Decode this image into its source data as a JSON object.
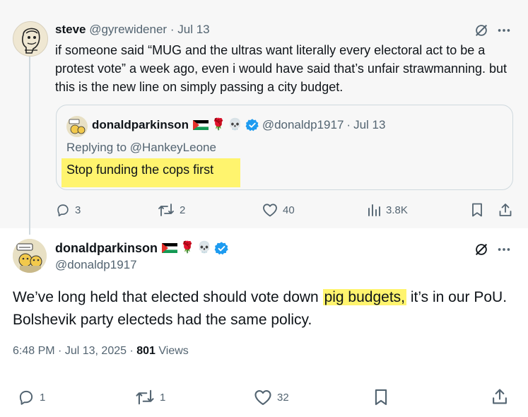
{
  "parent_tweet": {
    "author_name": "steve",
    "author_handle": "@gyrewidener",
    "separator": "·",
    "date": "Jul 13",
    "text": "if someone said “MUG and the ultras want literally every electoral act to be a protest vote” a week ago, even i would have said that’s unfair strawmanning. but this is the new line on simply passing a city budget.",
    "quoted": {
      "author_name": "donaldparkinson",
      "author_handle": "@donaldp1917",
      "date": "Jul 13",
      "replying_to": "Replying to @HankeyLeone",
      "text": "Stop funding the cops first"
    },
    "actions": {
      "replies": "3",
      "reposts": "2",
      "likes": "40",
      "views": "3.8K"
    }
  },
  "main_tweet": {
    "author_name": "donaldparkinson",
    "author_handle": "@donaldp1917",
    "text_before": "We’ve long held that elected should vote down ",
    "text_highlight": "pig budgets,",
    "text_after": " it’s in our PoU. Bolshevik party electeds had the same policy.",
    "time": "6:48 PM",
    "date": "Jul 13, 2025",
    "views_count": "801",
    "views_label": "Views",
    "actions": {
      "replies": "1",
      "reposts": "1",
      "likes": "32"
    }
  },
  "name_emojis": {
    "rose": "🌹",
    "skull": "💀"
  },
  "colors": {
    "verified_blue": "#1d9bf0",
    "highlight_yellow": "#fff46e",
    "secondary_text": "#536471"
  },
  "icons": [
    "grok-icon",
    "more-icon",
    "reply-icon",
    "repost-icon",
    "like-icon",
    "views-icon",
    "bookmark-icon",
    "share-icon",
    "verified-badge-icon",
    "palestine-flag-icon"
  ]
}
